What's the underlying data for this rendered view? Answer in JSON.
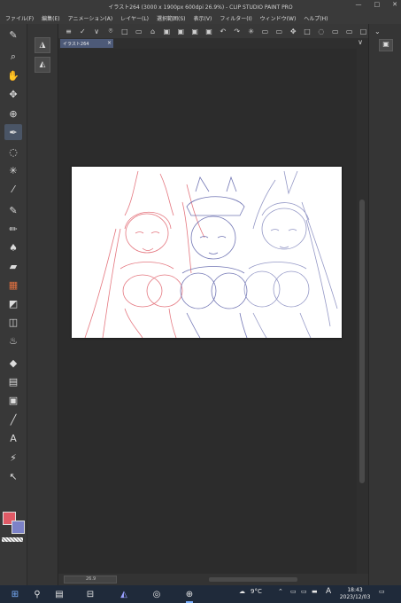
{
  "window": {
    "title": "イラスト264 (3000 x 1900px 600dpi 26.9%)  - CLIP STUDIO PAINT PRO",
    "controls": [
      "—",
      "□",
      "✕"
    ]
  },
  "menu": [
    "ファイル(F)",
    "編集(E)",
    "アニメーション(A)",
    "レイヤー(L)",
    "選択範囲(S)",
    "表示(V)",
    "フィルター(I)",
    "ウィンドウ(W)",
    "ヘルプ(H)"
  ],
  "tools": [
    {
      "name": "menu-pen-icon",
      "glyph": "✎"
    },
    {
      "name": "zoom-icon",
      "glyph": "⌕"
    },
    {
      "name": "hand-icon",
      "glyph": "✋"
    },
    {
      "name": "move-icon",
      "glyph": "✥"
    },
    {
      "name": "object-select-icon",
      "glyph": "⊕"
    },
    {
      "name": "pen-tool-icon",
      "glyph": "✒"
    },
    {
      "name": "lasso-icon",
      "glyph": "◌"
    },
    {
      "name": "magic-wand-icon",
      "glyph": "✳"
    },
    {
      "name": "eyedropper-icon",
      "glyph": "⁄"
    },
    {
      "name": "pen-icon",
      "glyph": "✎"
    },
    {
      "name": "pencil-icon",
      "glyph": "✏"
    },
    {
      "name": "brush-icon",
      "glyph": "♠"
    },
    {
      "name": "eraser-icon",
      "glyph": "▰"
    },
    {
      "name": "decoration-icon",
      "glyph": "▦"
    },
    {
      "name": "blend-icon",
      "glyph": "◩"
    },
    {
      "name": "airbrush-icon",
      "glyph": "◫"
    },
    {
      "name": "fill-icon",
      "glyph": "♨"
    },
    {
      "name": "bucket-icon",
      "glyph": "◆"
    },
    {
      "name": "gradient-icon",
      "glyph": "▤"
    },
    {
      "name": "frame-icon",
      "glyph": "▣"
    },
    {
      "name": "line-icon",
      "glyph": "╱"
    },
    {
      "name": "text-icon",
      "glyph": "A"
    },
    {
      "name": "balloon-icon",
      "glyph": "⚡"
    },
    {
      "name": "correct-line-icon",
      "glyph": "↖"
    }
  ],
  "subtools": [
    "◮",
    "◭"
  ],
  "command_bar": [
    "≡",
    "✓",
    "∨",
    "⌾",
    "□",
    "▭",
    "⌂",
    "▣",
    "▣",
    "▣",
    "▣",
    "↶",
    "↷",
    "✳",
    "▭",
    "▭",
    "✥",
    "□",
    "◌",
    "▭",
    "▭",
    "□"
  ],
  "document_tab": {
    "label": "イラスト264",
    "close": "×"
  },
  "tab_menu": "∨",
  "status": {
    "zoom": "26.9"
  },
  "right_panel": {
    "collapse": "⌄",
    "button": "▣"
  },
  "colors": {
    "main": "#e05a66",
    "sub": "#7c82c8",
    "accent": "#4d5a78"
  },
  "taskbar": {
    "start": "⊞",
    "search": "⚲",
    "apps": [
      "▤",
      "⊟",
      "◭",
      "◎",
      "⊕"
    ],
    "weather": "9°C",
    "tray": [
      "⌃",
      "▭",
      "▭",
      "▬",
      "A"
    ],
    "time": "18:43",
    "date": "2023/12/03",
    "notification": "▭"
  }
}
